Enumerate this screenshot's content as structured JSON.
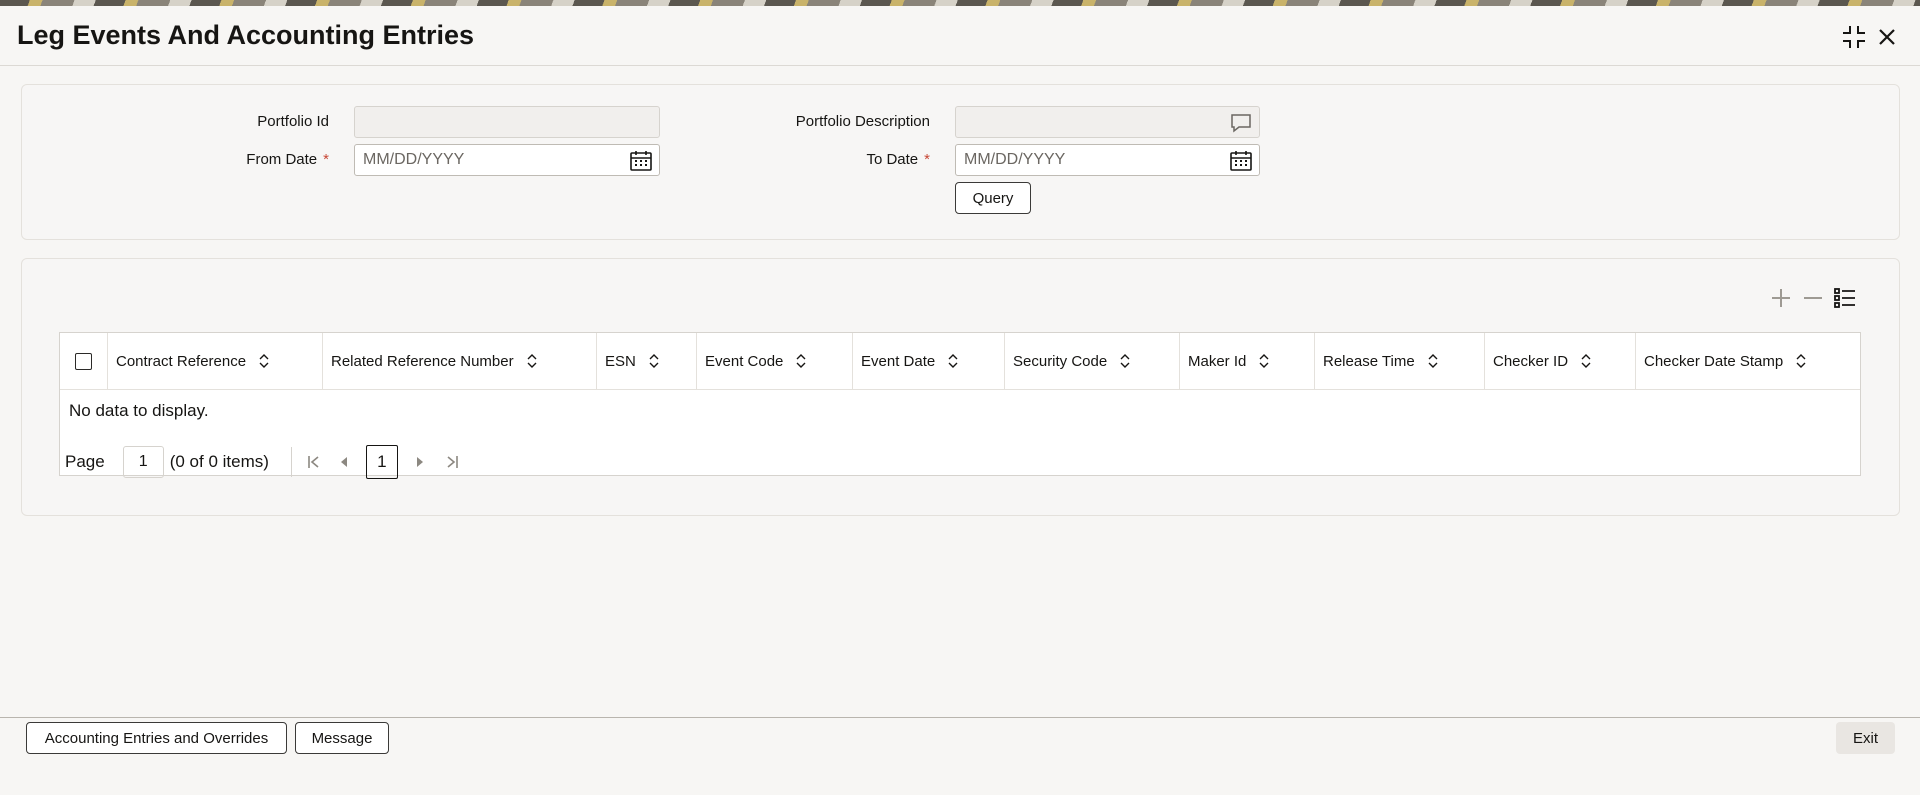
{
  "window": {
    "title": "Leg Events And Accounting Entries",
    "buttons": [
      "collapse-icon",
      "close-icon"
    ]
  },
  "form": {
    "portfolio_id_label": "Portfolio Id",
    "portfolio_id_value": "",
    "portfolio_description_label": "Portfolio Description",
    "portfolio_description_value": "",
    "from_date_label": "From Date",
    "from_date_placeholder": "MM/DD/YYYY",
    "to_date_label": "To Date",
    "to_date_placeholder": "MM/DD/YYYY",
    "required_marker": "*",
    "query_button": "Query"
  },
  "grid": {
    "tools": [
      "add-row-icon",
      "remove-row-icon",
      "column-settings-icon"
    ],
    "columns": [
      "Contract Reference",
      "Related Reference Number",
      "ESN",
      "Event Code",
      "Event Date",
      "Security Code",
      "Maker Id",
      "Release Time",
      "Checker ID",
      "Checker Date Stamp"
    ],
    "empty_message": "No data to display.",
    "pager": {
      "page_label": "Page",
      "page_value": "1",
      "items_text": "(0 of 0 items)",
      "current_page": "1"
    }
  },
  "footer": {
    "accounting_button": "Accounting Entries and Overrides",
    "message_button": "Message",
    "exit_button": "Exit"
  },
  "colors": {
    "required": "#c74634",
    "text": "#161513",
    "border": "#d6d3ce"
  }
}
